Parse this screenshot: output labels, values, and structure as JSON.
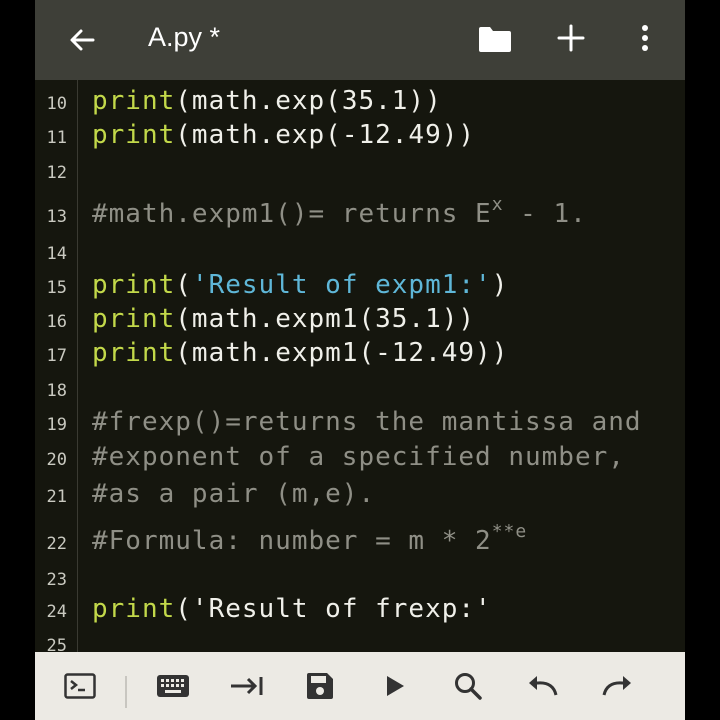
{
  "app": {
    "file_title": "A.py *"
  },
  "toolbar": {
    "icons": [
      "back-arrow-icon",
      "folder-icon",
      "plus-icon",
      "more-vertical-icon"
    ]
  },
  "editor": {
    "lines": [
      {
        "num": "10",
        "text": "print(math.exp(35.1))"
      },
      {
        "num": "11",
        "text": "print(math.exp(-12.49))"
      },
      {
        "num": "12",
        "text": ""
      },
      {
        "num": "13",
        "text": "#math.expm1()= returns E",
        "sup": "x",
        "tail": " - 1."
      },
      {
        "num": "14",
        "text": ""
      },
      {
        "num": "15",
        "text": "print('Result of expm1:')"
      },
      {
        "num": "16",
        "text": "print(math.expm1(35.1))"
      },
      {
        "num": "17",
        "text": "print(math.expm1(-12.49))"
      },
      {
        "num": "18",
        "text": ""
      },
      {
        "num": "19",
        "text": "#frexp()=returns the mantissa and"
      },
      {
        "num": "20",
        "text": "#exponent of a specified number,"
      },
      {
        "num": "21",
        "text": "#as a pair (m,e)."
      },
      {
        "num": "22",
        "text": "#Formula: number = m * 2",
        "sup": "**e"
      },
      {
        "num": "23",
        "text": ""
      },
      {
        "num": "24",
        "text": "print('Result of frexp:'"
      },
      {
        "num": "25",
        "text": ""
      }
    ]
  },
  "bottombar": {
    "icons": [
      "terminal-icon",
      "keyboard-icon",
      "tab-indent-icon",
      "save-icon",
      "run-icon",
      "search-icon",
      "undo-icon",
      "redo-icon"
    ]
  },
  "colors": {
    "topbar_bg": "#3e3f38",
    "editor_bg": "#15160e",
    "keyword": "#c3d94a",
    "string": "#5fb7d8",
    "comment": "#8f8f86",
    "bottombar_bg": "#eceae4"
  }
}
